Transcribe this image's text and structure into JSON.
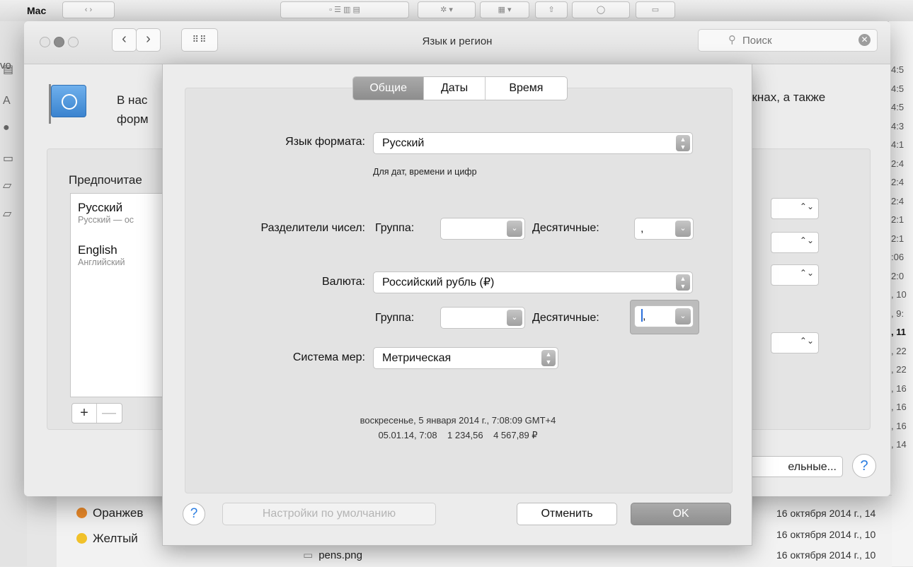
{
  "finder": {
    "window_title": "Mac",
    "sidebar_label": "vo",
    "tags": [
      {
        "label": "Оранжев",
        "color": "#ea8a2a"
      },
      {
        "label": "Желтый",
        "color": "#f1c12a"
      }
    ],
    "right_column_times": [
      "4:5",
      "4:5",
      "4:5",
      "4:3",
      "4:1",
      "2:4",
      "2:4",
      "2:4",
      "2:1",
      "2:1",
      ":06",
      "2:0",
      ", 10",
      ", 9:",
      ", 11",
      ", 22",
      ", 22",
      ", 16",
      ", 16",
      ", 16",
      ", 14"
    ],
    "right_column_bold_index": 14,
    "date_rows": [
      "16 октября 2014 г., 14",
      "16 октября 2014 г., 10",
      "16 октября 2014 г., 10"
    ],
    "file_name": "pens.png"
  },
  "prefs": {
    "title": "Язык и регион",
    "search_placeholder": "Поиск",
    "intro_line1": "В нас",
    "intro_line2": "форм",
    "intro_right": "окнах, а также",
    "preferred_heading": "Предпочитае",
    "languages": [
      {
        "name": "Русский",
        "sub": "Русский — ос"
      },
      {
        "name": "English",
        "sub": "Английский"
      }
    ],
    "add_label": "+",
    "remove_label": "—",
    "advanced_label": "ельные...",
    "help_label": "?",
    "flag_icon": "un-flag-icon"
  },
  "sheet": {
    "tabs": [
      "Общие",
      "Даты",
      "Время"
    ],
    "active_tab": 0,
    "format_language_label": "Язык формата:",
    "format_language_value": "Русский",
    "format_language_hint": "Для дат, времени и цифр",
    "number_separators_label": "Разделители чисел:",
    "group_label": "Группа:",
    "decimal_label": "Десятичные:",
    "number_group_value": "",
    "number_decimal_value": ",",
    "currency_label": "Валюта:",
    "currency_value": "Российский рубль (₽)",
    "currency_group_label": "Группа:",
    "currency_decimal_label": "Десятичные:",
    "currency_group_value": "",
    "currency_decimal_value": ",",
    "measure_label": "Система мер:",
    "measure_value": "Метрическая",
    "sample_line1": "воскресенье, 5 января 2014 г., 7:08:09 GMT+4",
    "sample_line2": "05.01.14, 7:08    1 234,56    4 567,89 ₽",
    "help_label": "?",
    "defaults_button": "Настройки по умолчанию",
    "cancel_button": "Отменить",
    "ok_button": "OK"
  }
}
